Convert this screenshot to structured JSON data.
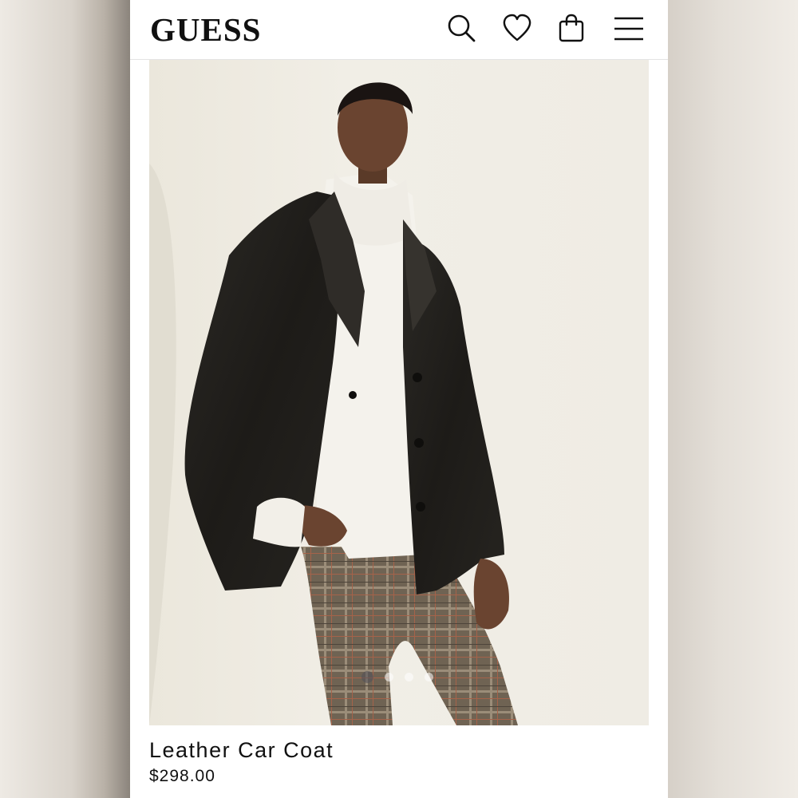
{
  "header": {
    "logo": "GUESS",
    "icons": [
      "search-icon",
      "heart-icon",
      "shopping-bag-icon",
      "menu-icon"
    ]
  },
  "hero": {
    "slides_total": 4,
    "active_slide": 1
  },
  "product": {
    "name": "Leather Car Coat",
    "price": "$298.00"
  },
  "colors": {
    "text": "#111111",
    "background": "#ffffff",
    "hero_backdrop": "#efebe3"
  }
}
